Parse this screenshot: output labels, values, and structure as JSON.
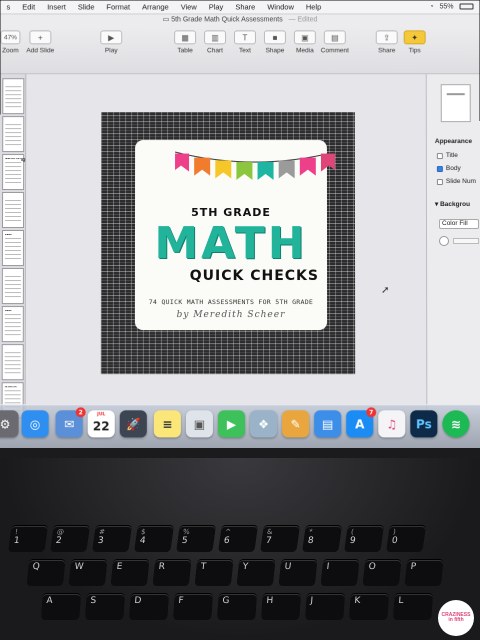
{
  "menubar": {
    "items": [
      "Edit",
      "Insert",
      "Slide",
      "Format",
      "Arrange",
      "View",
      "Play",
      "Share",
      "Window",
      "Help"
    ],
    "battery": "55%"
  },
  "window": {
    "title": "5th Grade Math Quick Assessments",
    "status": "Edited"
  },
  "toolbar": {
    "zoom": "47%",
    "zoom_label": "Zoom",
    "add_slide": "Add Slide",
    "play": "Play",
    "table": "Table",
    "chart": "Chart",
    "text": "Text",
    "shape": "Shape",
    "media": "Media",
    "comment": "Comment",
    "share": "Share",
    "tips": "Tips"
  },
  "navigator": {
    "tags": [
      "",
      "",
      "",
      "TECHNIQ",
      "",
      "ITE",
      "",
      "ITE",
      "",
      "INDIG"
    ]
  },
  "slide": {
    "grade": "5TH GRADE",
    "subject": "MATH",
    "product": "QUICK CHECKS",
    "subtitle": "74 QUICK MATH ASSESSMENTS FOR 5TH GRADE",
    "author": "by Meredith Scheer",
    "bunting_colors": [
      "#ee3f8b",
      "#f27c2d",
      "#f6c728",
      "#8cc63f",
      "#1fb5a3",
      "#9b9b9b",
      "#ee3f8b",
      "#e0457a"
    ]
  },
  "inspector": {
    "appearance": "Appearance",
    "title_opt": "Title",
    "body_opt": "Body",
    "slide_number_opt": "Slide Num",
    "background": "Backgrou",
    "fill": "Color Fill"
  },
  "dock": {
    "mail_badge": "2",
    "calendar_month": "JUL",
    "calendar_day": "22",
    "appstore_badge": "7"
  },
  "keyboard": {
    "row1": [
      "!\n1",
      "@\n2",
      "#\n3",
      "$\n4",
      "%\n5",
      "^\n6",
      "&\n7",
      "*\n8",
      "(\n9",
      ")\n0"
    ],
    "row2": [
      "Q",
      "W",
      "E",
      "R",
      "T",
      "Y",
      "U",
      "I",
      "O",
      "P"
    ],
    "row3": [
      "A",
      "S",
      "D",
      "F",
      "G",
      "H",
      "J",
      "K",
      "L"
    ]
  },
  "watermark": {
    "line1": "CRAZINESS",
    "line2": "in fifth"
  }
}
